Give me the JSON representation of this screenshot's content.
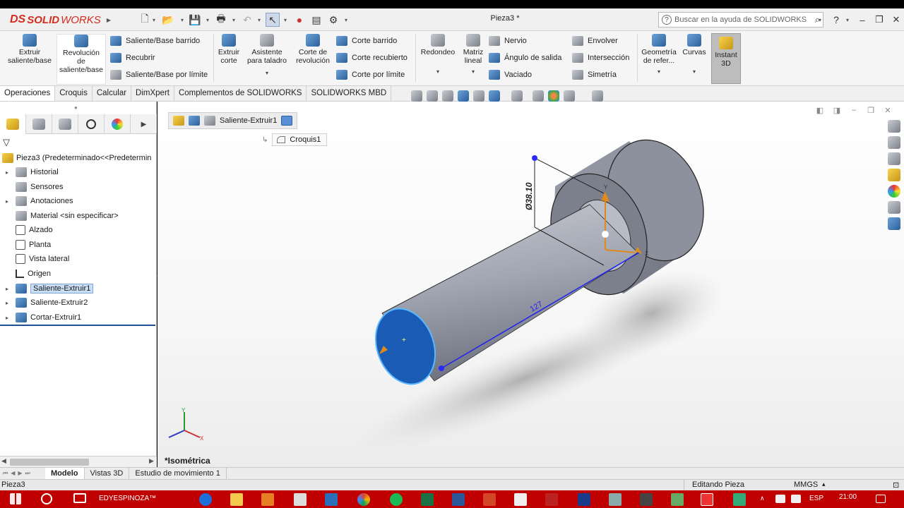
{
  "app": {
    "logo_ds": "DS",
    "logo_bold": "SOLID",
    "logo_light": "WORKS",
    "document_title": "Pieza3 *",
    "search_placeholder": "Buscar en la ayuda de SOLIDWORKS"
  },
  "ribbon": {
    "extruir_saliente": "Extruir saliente/base",
    "revolucion_saliente": "Revolución de saliente/base",
    "saliente_barrido": "Saliente/Base barrido",
    "recubrir": "Recubrir",
    "saliente_limite": "Saliente/Base por límite",
    "extruir_corte": "Extruir corte",
    "asistente_taladro": "Asistente para taladro",
    "corte_revolucion": "Corte de revolución",
    "corte_barrido": "Corte barrido",
    "corte_recubierto": "Corte recubierto",
    "corte_limite": "Corte por límite",
    "redondeo": "Redondeo",
    "matriz_lineal": "Matriz lineal",
    "nervio": "Nervio",
    "angulo_salida": "Ángulo de salida",
    "vaciado": "Vaciado",
    "envolver": "Envolver",
    "interseccion": "Intersección",
    "simetria": "Simetría",
    "geometria_referencia": "Geometría de refer...",
    "curvas": "Curvas",
    "instant3d": "Instant 3D"
  },
  "tabs": [
    "Operaciones",
    "Croquis",
    "Calcular",
    "DimXpert",
    "Complementos de SOLIDWORKS",
    "SOLIDWORKS MBD"
  ],
  "tree": {
    "root": "Pieza3  (Predeterminado<<Predetermin",
    "items": [
      {
        "label": "Historial",
        "expandable": true
      },
      {
        "label": "Sensores",
        "expandable": false
      },
      {
        "label": "Anotaciones",
        "expandable": true
      },
      {
        "label": "Material <sin especificar>",
        "expandable": false
      },
      {
        "label": "Alzado",
        "expandable": false
      },
      {
        "label": "Planta",
        "expandable": false
      },
      {
        "label": "Vista lateral",
        "expandable": false
      },
      {
        "label": "Origen",
        "expandable": false
      },
      {
        "label": "Saliente-Extruir1",
        "expandable": true,
        "selected": true
      },
      {
        "label": "Saliente-Extruir2",
        "expandable": true
      },
      {
        "label": "Cortar-Extruir1",
        "expandable": true
      }
    ]
  },
  "viewport": {
    "breadcrumb_feature": "Saliente-Extruir1",
    "croquis_label": "Croquis1",
    "view_name": "*Isométrica",
    "dimension_diameter": "Ø38.10",
    "dimension_length": "127",
    "axis_y": "Y",
    "axis_x": "X"
  },
  "bottom_tabs": [
    "Modelo",
    "Vistas 3D",
    "Estudio de movimiento 1"
  ],
  "status": {
    "left": "Pieza3",
    "editing": "Editando Pieza",
    "units": "MMGS"
  },
  "taskbar": {
    "user_label": "EDYESPINOZA™",
    "lang": "ESP",
    "time": "21:00"
  },
  "colors": {
    "accent_red": "#d52b1e",
    "model_grey": "#a4a8b3",
    "face_selected": "#1a5bb5",
    "taskbar": "#c00000"
  }
}
